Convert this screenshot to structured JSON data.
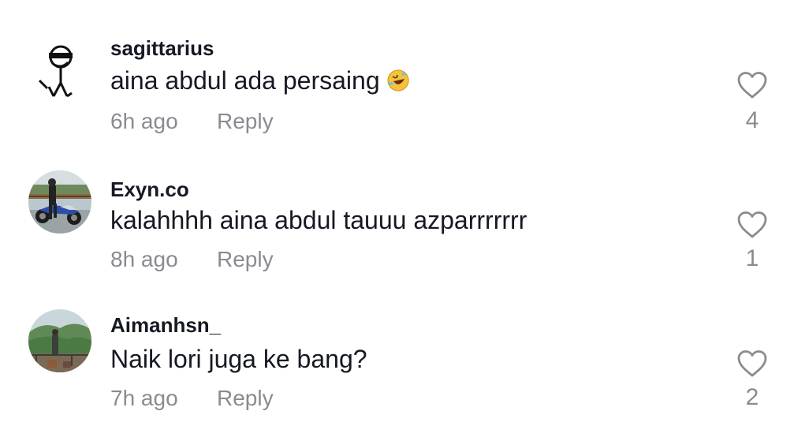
{
  "comments": [
    {
      "username": "sagittarius",
      "text": "aina abdul ada persaing",
      "emoji": "rolling-on-floor-laughing-emoji",
      "time": "6h ago",
      "reply_label": "Reply",
      "likes": "4",
      "avatar": "stick-figure-sunglasses-avatar"
    },
    {
      "username": "Exyn.co",
      "text": "kalahhhh aina abdul tauuu azparrrrrrr",
      "time": "8h ago",
      "reply_label": "Reply",
      "likes": "1",
      "avatar": "motorcycle-photo-avatar"
    },
    {
      "username": "Aimanhsn_",
      "text": "Naik lori juga ke bang?",
      "time": "7h ago",
      "reply_label": "Reply",
      "likes": "2",
      "avatar": "hills-photo-avatar"
    }
  ],
  "colors": {
    "text_primary": "#161823",
    "text_secondary": "#8a8b91",
    "background": "#ffffff"
  }
}
